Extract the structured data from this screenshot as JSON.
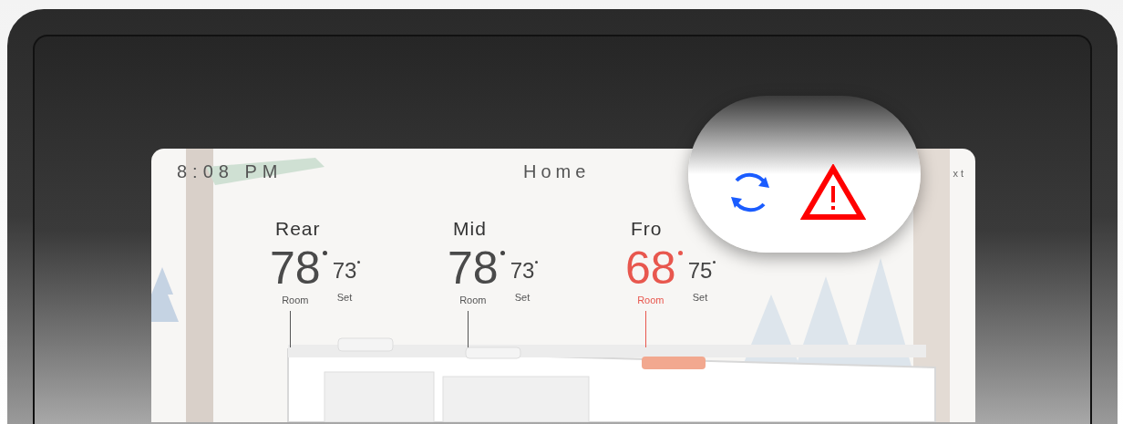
{
  "header": {
    "time": "8:08 PM",
    "title": "Home",
    "right_text_fragment": "xt"
  },
  "zones": [
    {
      "name": "Rear",
      "room_temp": "78",
      "room_label": "Room",
      "set_temp": "73",
      "set_label": "Set",
      "alert": false
    },
    {
      "name": "Mid",
      "room_temp": "78",
      "room_label": "Room",
      "set_temp": "73",
      "set_label": "Set",
      "alert": false
    },
    {
      "name": "Fro",
      "room_temp": "68",
      "room_label": "Room",
      "set_temp": "75",
      "set_label": "Set",
      "alert": true
    }
  ],
  "magnifier": {
    "icons": [
      {
        "kind": "sync"
      },
      {
        "kind": "warning"
      }
    ]
  }
}
